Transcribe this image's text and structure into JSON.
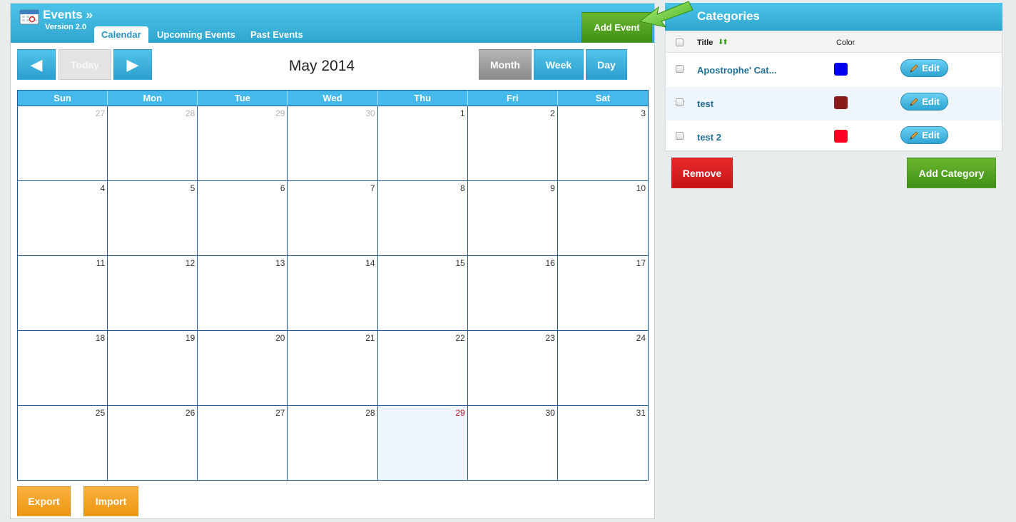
{
  "header": {
    "title": "Events »",
    "version": "Version 2.0",
    "tabs": [
      {
        "label": "Calendar",
        "active": true
      },
      {
        "label": "Upcoming Events",
        "active": false
      },
      {
        "label": "Past Events",
        "active": false
      }
    ],
    "add_event_label": "Add Event"
  },
  "toolbar": {
    "prev_icon": "◀",
    "today_label": "Today",
    "next_icon": "▶",
    "calendar_title": "May 2014",
    "views": [
      "Month",
      "Week",
      "Day"
    ],
    "active_view": "Month"
  },
  "calendar": {
    "weekdays": [
      "Sun",
      "Mon",
      "Tue",
      "Wed",
      "Thu",
      "Fri",
      "Sat"
    ],
    "weeks": [
      [
        {
          "d": "27",
          "other": true
        },
        {
          "d": "28",
          "other": true
        },
        {
          "d": "29",
          "other": true
        },
        {
          "d": "30",
          "other": true
        },
        {
          "d": "1"
        },
        {
          "d": "2"
        },
        {
          "d": "3"
        }
      ],
      [
        {
          "d": "4"
        },
        {
          "d": "5"
        },
        {
          "d": "6"
        },
        {
          "d": "7"
        },
        {
          "d": "8"
        },
        {
          "d": "9"
        },
        {
          "d": "10"
        }
      ],
      [
        {
          "d": "11"
        },
        {
          "d": "12"
        },
        {
          "d": "13"
        },
        {
          "d": "14"
        },
        {
          "d": "15"
        },
        {
          "d": "16"
        },
        {
          "d": "17"
        }
      ],
      [
        {
          "d": "18"
        },
        {
          "d": "19"
        },
        {
          "d": "20"
        },
        {
          "d": "21"
        },
        {
          "d": "22"
        },
        {
          "d": "23"
        },
        {
          "d": "24"
        }
      ],
      [
        {
          "d": "25"
        },
        {
          "d": "26"
        },
        {
          "d": "27"
        },
        {
          "d": "28"
        },
        {
          "d": "29",
          "today": true
        },
        {
          "d": "30"
        },
        {
          "d": "31"
        }
      ]
    ]
  },
  "footer": {
    "export_label": "Export",
    "import_label": "Import"
  },
  "categories": {
    "title": "Categories",
    "columns": {
      "title": "Title",
      "color": "Color",
      "sort_icon": "⬇⬆"
    },
    "items": [
      {
        "name": "Apostrophe' Cat...",
        "color": "#0000ee",
        "edit_label": "Edit"
      },
      {
        "name": "test",
        "color": "#8b1a1a",
        "edit_label": "Edit"
      },
      {
        "name": "test 2",
        "color": "#ff0022",
        "edit_label": "Edit"
      }
    ],
    "remove_label": "Remove",
    "add_label": "Add Category"
  },
  "colors": {
    "header_blue": "#3bb6df",
    "green": "#4fa11f",
    "orange": "#f2a326",
    "red": "#d81f1f"
  }
}
